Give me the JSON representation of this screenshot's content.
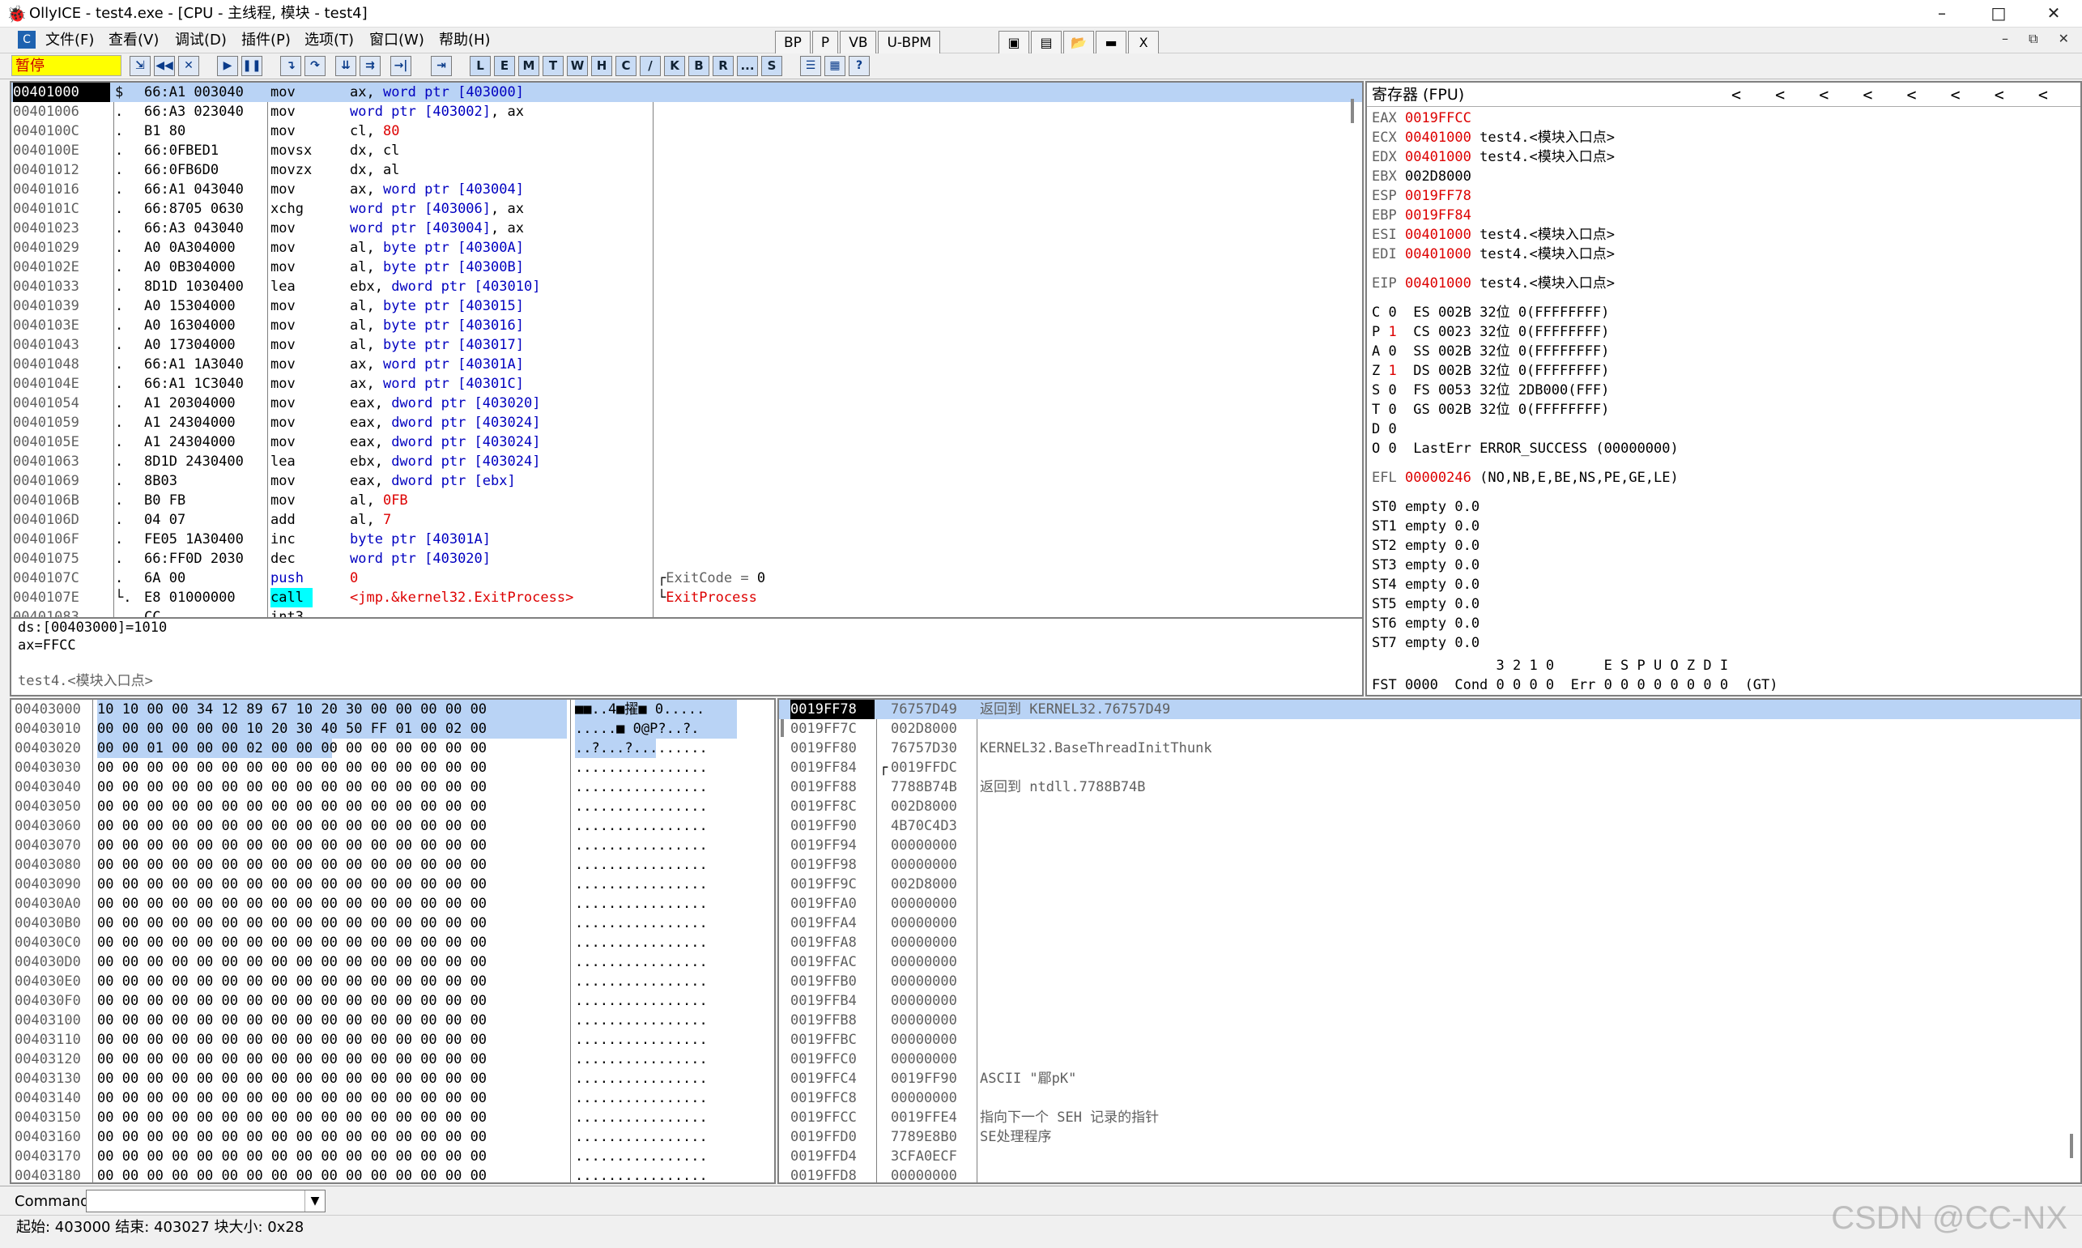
{
  "window": {
    "title": "OllyICE - test4.exe - [CPU - 主线程, 模块 - test4]",
    "min": "–",
    "max": "□",
    "close": "✕"
  },
  "menu": [
    "文件(F)",
    "查看(V)",
    "调试(D)",
    "插件(P)",
    "选项(T)",
    "窗口(W)",
    "帮助(H)"
  ],
  "main_buttons": [
    "BP",
    "P",
    "VB",
    "U-BPM"
  ],
  "main_close": "X",
  "mdi_controls": "– ⧉ ✕",
  "toolbar": {
    "status": "暂停",
    "letters": [
      "L",
      "E",
      "M",
      "T",
      "W",
      "H",
      "C",
      "/",
      "K",
      "B",
      "R",
      "...",
      "S"
    ]
  },
  "disasm": {
    "rows": [
      {
        "addr": "00401000",
        "mark": "$",
        "hex": "66:A1 003040",
        "mn": "mov",
        "op": [
          [
            "ax, ",
            ""
          ],
          [
            "word ptr",
            "blue"
          ],
          [
            " [403000]",
            "blue"
          ]
        ],
        "cm": []
      },
      {
        "addr": "00401006",
        "mark": ".",
        "hex": "66:A3 023040",
        "mn": "mov",
        "op": [
          [
            "word ptr",
            "blue"
          ],
          [
            " [403002]",
            "blue"
          ],
          [
            ", ax",
            ""
          ]
        ],
        "cm": []
      },
      {
        "addr": "0040100C",
        "mark": ".",
        "hex": "B1 80",
        "mn": "mov",
        "op": [
          [
            "cl, ",
            ""
          ],
          [
            "80",
            "red"
          ]
        ],
        "cm": []
      },
      {
        "addr": "0040100E",
        "mark": ".",
        "hex": "66:0FBED1",
        "mn": "movsx",
        "op": [
          [
            "dx, cl",
            ""
          ]
        ],
        "cm": []
      },
      {
        "addr": "00401012",
        "mark": ".",
        "hex": "66:0FB6D0",
        "mn": "movzx",
        "op": [
          [
            "dx, al",
            ""
          ]
        ],
        "cm": []
      },
      {
        "addr": "00401016",
        "mark": ".",
        "hex": "66:A1 043040",
        "mn": "mov",
        "op": [
          [
            "ax, ",
            ""
          ],
          [
            "word ptr",
            "blue"
          ],
          [
            " [403004]",
            "blue"
          ]
        ],
        "cm": []
      },
      {
        "addr": "0040101C",
        "mark": ".",
        "hex": "66:8705 0630",
        "mn": "xchg",
        "op": [
          [
            "word ptr",
            "blue"
          ],
          [
            " [403006]",
            "blue"
          ],
          [
            ", ax",
            ""
          ]
        ],
        "cm": []
      },
      {
        "addr": "00401023",
        "mark": ".",
        "hex": "66:A3 043040",
        "mn": "mov",
        "op": [
          [
            "word ptr",
            "blue"
          ],
          [
            " [403004]",
            "blue"
          ],
          [
            ", ax",
            ""
          ]
        ],
        "cm": []
      },
      {
        "addr": "00401029",
        "mark": ".",
        "hex": "A0 0A304000",
        "mn": "mov",
        "op": [
          [
            "al, ",
            ""
          ],
          [
            "byte ptr",
            "blue"
          ],
          [
            " [40300A]",
            "blue"
          ]
        ],
        "cm": []
      },
      {
        "addr": "0040102E",
        "mark": ".",
        "hex": "A0 0B304000",
        "mn": "mov",
        "op": [
          [
            "al, ",
            ""
          ],
          [
            "byte ptr",
            "blue"
          ],
          [
            " [40300B]",
            "blue"
          ]
        ],
        "cm": []
      },
      {
        "addr": "00401033",
        "mark": ".",
        "hex": "8D1D 1030400",
        "mn": "lea",
        "op": [
          [
            "ebx, ",
            ""
          ],
          [
            "dword ptr",
            "blue"
          ],
          [
            " [403010]",
            "blue"
          ]
        ],
        "cm": []
      },
      {
        "addr": "00401039",
        "mark": ".",
        "hex": "A0 15304000",
        "mn": "mov",
        "op": [
          [
            "al, ",
            ""
          ],
          [
            "byte ptr",
            "blue"
          ],
          [
            " [403015]",
            "blue"
          ]
        ],
        "cm": []
      },
      {
        "addr": "0040103E",
        "mark": ".",
        "hex": "A0 16304000",
        "mn": "mov",
        "op": [
          [
            "al, ",
            ""
          ],
          [
            "byte ptr",
            "blue"
          ],
          [
            " [403016]",
            "blue"
          ]
        ],
        "cm": []
      },
      {
        "addr": "00401043",
        "mark": ".",
        "hex": "A0 17304000",
        "mn": "mov",
        "op": [
          [
            "al, ",
            ""
          ],
          [
            "byte ptr",
            "blue"
          ],
          [
            " [403017]",
            "blue"
          ]
        ],
        "cm": []
      },
      {
        "addr": "00401048",
        "mark": ".",
        "hex": "66:A1 1A3040",
        "mn": "mov",
        "op": [
          [
            "ax, ",
            ""
          ],
          [
            "word ptr",
            "blue"
          ],
          [
            " [40301A]",
            "blue"
          ]
        ],
        "cm": []
      },
      {
        "addr": "0040104E",
        "mark": ".",
        "hex": "66:A1 1C3040",
        "mn": "mov",
        "op": [
          [
            "ax, ",
            ""
          ],
          [
            "word ptr",
            "blue"
          ],
          [
            " [40301C]",
            "blue"
          ]
        ],
        "cm": []
      },
      {
        "addr": "00401054",
        "mark": ".",
        "hex": "A1 20304000",
        "mn": "mov",
        "op": [
          [
            "eax, ",
            ""
          ],
          [
            "dword ptr",
            "blue"
          ],
          [
            " [403020]",
            "blue"
          ]
        ],
        "cm": []
      },
      {
        "addr": "00401059",
        "mark": ".",
        "hex": "A1 24304000",
        "mn": "mov",
        "op": [
          [
            "eax, ",
            ""
          ],
          [
            "dword ptr",
            "blue"
          ],
          [
            " [403024]",
            "blue"
          ]
        ],
        "cm": []
      },
      {
        "addr": "0040105E",
        "mark": ".",
        "hex": "A1 24304000",
        "mn": "mov",
        "op": [
          [
            "eax, ",
            ""
          ],
          [
            "dword ptr",
            "blue"
          ],
          [
            " [403024]",
            "blue"
          ]
        ],
        "cm": []
      },
      {
        "addr": "00401063",
        "mark": ".",
        "hex": "8D1D 2430400",
        "mn": "lea",
        "op": [
          [
            "ebx, ",
            ""
          ],
          [
            "dword ptr",
            "blue"
          ],
          [
            " [403024]",
            "blue"
          ]
        ],
        "cm": []
      },
      {
        "addr": "00401069",
        "mark": ".",
        "hex": "8B03",
        "mn": "mov",
        "op": [
          [
            "eax, ",
            ""
          ],
          [
            "dword ptr",
            "blue"
          ],
          [
            " [ebx]",
            "blue"
          ]
        ],
        "cm": []
      },
      {
        "addr": "0040106B",
        "mark": ".",
        "hex": "B0 FB",
        "mn": "mov",
        "op": [
          [
            "al, ",
            ""
          ],
          [
            "0FB",
            "red"
          ]
        ],
        "cm": []
      },
      {
        "addr": "0040106D",
        "mark": ".",
        "hex": "04 07",
        "mn": "add",
        "op": [
          [
            "al, ",
            ""
          ],
          [
            "7",
            "red"
          ]
        ],
        "cm": []
      },
      {
        "addr": "0040106F",
        "mark": ".",
        "hex": "FE05 1A30400",
        "mn": "inc",
        "op": [
          [
            "byte ptr",
            "blue"
          ],
          [
            " [40301A]",
            "blue"
          ]
        ],
        "cm": []
      },
      {
        "addr": "00401075",
        "mark": ".",
        "hex": "66:FF0D 2030",
        "mn": "dec",
        "op": [
          [
            "word ptr",
            "blue"
          ],
          [
            " [403020]",
            "blue"
          ]
        ],
        "cm": []
      },
      {
        "addr": "0040107C",
        "mark": ".",
        "hex": "6A 00",
        "mn": "push",
        "op": [
          [
            "0",
            "red"
          ]
        ],
        "cm": [
          [
            "┌",
            ""
          ],
          [
            "ExitCode = ",
            "gray"
          ],
          [
            "0",
            ""
          ]
        ]
      },
      {
        "addr": "0040107E",
        "mark": "└.",
        "hex": "E8 01000000",
        "mn": "call",
        "op": [
          [
            "<jmp.&kernel32.ExitProcess>",
            "red"
          ]
        ],
        "cm": [
          [
            "└",
            ""
          ],
          [
            "ExitProcess",
            "red"
          ]
        ]
      },
      {
        "addr": "00401083",
        "mark": "",
        "hex": "CC",
        "mn": "int3",
        "op": [],
        "cm": []
      }
    ],
    "info": [
      "ds:[00403000]=1010",
      "ax=FFCC",
      "",
      "test4.<模块入口点>"
    ]
  },
  "registers": {
    "header": "寄存器 (FPU)",
    "arrows": "<  <  <  <  <  <  <  <",
    "gp": [
      {
        "n": "EAX",
        "v": "0019FFCC",
        "c": ""
      },
      {
        "n": "ECX",
        "v": "00401000",
        "c": "test4.<模块入口点>"
      },
      {
        "n": "EDX",
        "v": "00401000",
        "c": "test4.<模块入口点>"
      },
      {
        "n": "EBX",
        "v": "002D8000",
        "c": ""
      },
      {
        "n": "ESP",
        "v": "0019FF78",
        "c": ""
      },
      {
        "n": "EBP",
        "v": "0019FF84",
        "c": ""
      },
      {
        "n": "ESI",
        "v": "00401000",
        "c": "test4.<模块入口点>"
      },
      {
        "n": "EDI",
        "v": "00401000",
        "c": "test4.<模块入口点>"
      }
    ],
    "eip": {
      "n": "EIP",
      "v": "00401000",
      "c": "test4.<模块入口点>"
    },
    "flags": [
      {
        "f": "C",
        "v": "0",
        "rest": "ES 002B 32位 0(FFFFFFFF)"
      },
      {
        "f": "P",
        "v": "1",
        "rest": "CS 0023 32位 0(FFFFFFFF)"
      },
      {
        "f": "A",
        "v": "0",
        "rest": "SS 002B 32位 0(FFFFFFFF)"
      },
      {
        "f": "Z",
        "v": "1",
        "rest": "DS 002B 32位 0(FFFFFFFF)"
      },
      {
        "f": "S",
        "v": "0",
        "rest": "FS 0053 32位 2DB000(FFF)"
      },
      {
        "f": "T",
        "v": "0",
        "rest": "GS 002B 32位 0(FFFFFFFF)"
      },
      {
        "f": "D",
        "v": "0",
        "rest": ""
      },
      {
        "f": "O",
        "v": "0",
        "rest": "LastErr ERROR_SUCCESS (00000000)"
      }
    ],
    "efl": {
      "n": "EFL",
      "v": "00000246",
      "c": "(NO,NB,E,BE,NS,PE,GE,LE)"
    },
    "fpu": [
      "ST0 empty 0.0",
      "ST1 empty 0.0",
      "ST2 empty 0.0",
      "ST3 empty 0.0",
      "ST4 empty 0.0",
      "ST5 empty 0.0",
      "ST6 empty 0.0",
      "ST7 empty 0.0"
    ],
    "fst_hdr": "               3 2 1 0      E S P U O Z D I",
    "fst": "FST 0000  Cond 0 0 0 0  Err 0 0 0 0 0 0 0 0  (GT)"
  },
  "dump": {
    "rows": [
      {
        "a": "00403000",
        "h": "10 10 00 00 34 12 89 67 10 20 30 00 00 00 00 00",
        "s": "■■..4■擢■ 0.....",
        "sel": 16
      },
      {
        "a": "00403010",
        "h": "00 00 00 00 00 00 10 20 30 40 50 FF 01 00 02 00",
        "s": ".....■ 0@P?..?.",
        "sel": 16
      },
      {
        "a": "00403020",
        "h": "00 00 01 00 00 00 02 00 00 00 00 00 00 00 00 00",
        "s": "..?...?.........",
        "sel": 8
      },
      {
        "a": "00403030",
        "h": "00 00 00 00 00 00 00 00 00 00 00 00 00 00 00 00",
        "s": "................",
        "sel": 0
      },
      {
        "a": "00403040",
        "h": "00 00 00 00 00 00 00 00 00 00 00 00 00 00 00 00",
        "s": "................",
        "sel": 0
      },
      {
        "a": "00403050",
        "h": "00 00 00 00 00 00 00 00 00 00 00 00 00 00 00 00",
        "s": "................",
        "sel": 0
      },
      {
        "a": "00403060",
        "h": "00 00 00 00 00 00 00 00 00 00 00 00 00 00 00 00",
        "s": "................",
        "sel": 0
      },
      {
        "a": "00403070",
        "h": "00 00 00 00 00 00 00 00 00 00 00 00 00 00 00 00",
        "s": "................",
        "sel": 0
      },
      {
        "a": "00403080",
        "h": "00 00 00 00 00 00 00 00 00 00 00 00 00 00 00 00",
        "s": "................",
        "sel": 0
      },
      {
        "a": "00403090",
        "h": "00 00 00 00 00 00 00 00 00 00 00 00 00 00 00 00",
        "s": "................",
        "sel": 0
      },
      {
        "a": "004030A0",
        "h": "00 00 00 00 00 00 00 00 00 00 00 00 00 00 00 00",
        "s": "................",
        "sel": 0
      },
      {
        "a": "004030B0",
        "h": "00 00 00 00 00 00 00 00 00 00 00 00 00 00 00 00",
        "s": "................",
        "sel": 0
      },
      {
        "a": "004030C0",
        "h": "00 00 00 00 00 00 00 00 00 00 00 00 00 00 00 00",
        "s": "................",
        "sel": 0
      },
      {
        "a": "004030D0",
        "h": "00 00 00 00 00 00 00 00 00 00 00 00 00 00 00 00",
        "s": "................",
        "sel": 0
      },
      {
        "a": "004030E0",
        "h": "00 00 00 00 00 00 00 00 00 00 00 00 00 00 00 00",
        "s": "................",
        "sel": 0
      },
      {
        "a": "004030F0",
        "h": "00 00 00 00 00 00 00 00 00 00 00 00 00 00 00 00",
        "s": "................",
        "sel": 0
      },
      {
        "a": "00403100",
        "h": "00 00 00 00 00 00 00 00 00 00 00 00 00 00 00 00",
        "s": "................",
        "sel": 0
      },
      {
        "a": "00403110",
        "h": "00 00 00 00 00 00 00 00 00 00 00 00 00 00 00 00",
        "s": "................",
        "sel": 0
      },
      {
        "a": "00403120",
        "h": "00 00 00 00 00 00 00 00 00 00 00 00 00 00 00 00",
        "s": "................",
        "sel": 0
      },
      {
        "a": "00403130",
        "h": "00 00 00 00 00 00 00 00 00 00 00 00 00 00 00 00",
        "s": "................",
        "sel": 0
      },
      {
        "a": "00403140",
        "h": "00 00 00 00 00 00 00 00 00 00 00 00 00 00 00 00",
        "s": "................",
        "sel": 0
      },
      {
        "a": "00403150",
        "h": "00 00 00 00 00 00 00 00 00 00 00 00 00 00 00 00",
        "s": "................",
        "sel": 0
      },
      {
        "a": "00403160",
        "h": "00 00 00 00 00 00 00 00 00 00 00 00 00 00 00 00",
        "s": "................",
        "sel": 0
      },
      {
        "a": "00403170",
        "h": "00 00 00 00 00 00 00 00 00 00 00 00 00 00 00 00",
        "s": "................",
        "sel": 0
      },
      {
        "a": "00403180",
        "h": "00 00 00 00 00 00 00 00 00 00 00 00 00 00 00 00",
        "s": "................",
        "sel": 0
      }
    ]
  },
  "stack": {
    "rows": [
      {
        "a": "0019FF78",
        "v": "76757D49",
        "c": "返回到 KERNEL32.76757D49",
        "m": ""
      },
      {
        "a": "0019FF7C",
        "v": "002D8000",
        "c": "",
        "m": ""
      },
      {
        "a": "0019FF80",
        "v": "76757D30",
        "c": "KERNEL32.BaseThreadInitThunk",
        "m": ""
      },
      {
        "a": "0019FF84",
        "v": "0019FFDC",
        "c": "",
        "m": "┌"
      },
      {
        "a": "0019FF88",
        "v": "7788B74B",
        "c": "返回到 ntdll.7788B74B",
        "m": ""
      },
      {
        "a": "0019FF8C",
        "v": "002D8000",
        "c": "",
        "m": ""
      },
      {
        "a": "0019FF90",
        "v": "4B70C4D3",
        "c": "",
        "m": ""
      },
      {
        "a": "0019FF94",
        "v": "00000000",
        "c": "",
        "m": ""
      },
      {
        "a": "0019FF98",
        "v": "00000000",
        "c": "",
        "m": ""
      },
      {
        "a": "0019FF9C",
        "v": "002D8000",
        "c": "",
        "m": ""
      },
      {
        "a": "0019FFA0",
        "v": "00000000",
        "c": "",
        "m": ""
      },
      {
        "a": "0019FFA4",
        "v": "00000000",
        "c": "",
        "m": ""
      },
      {
        "a": "0019FFA8",
        "v": "00000000",
        "c": "",
        "m": ""
      },
      {
        "a": "0019FFAC",
        "v": "00000000",
        "c": "",
        "m": ""
      },
      {
        "a": "0019FFB0",
        "v": "00000000",
        "c": "",
        "m": ""
      },
      {
        "a": "0019FFB4",
        "v": "00000000",
        "c": "",
        "m": ""
      },
      {
        "a": "0019FFB8",
        "v": "00000000",
        "c": "",
        "m": ""
      },
      {
        "a": "0019FFBC",
        "v": "00000000",
        "c": "",
        "m": ""
      },
      {
        "a": "0019FFC0",
        "v": "00000000",
        "c": "",
        "m": ""
      },
      {
        "a": "0019FFC4",
        "v": "0019FF90",
        "c": "ASCII \"郿pK\"",
        "m": ""
      },
      {
        "a": "0019FFC8",
        "v": "00000000",
        "c": "",
        "m": ""
      },
      {
        "a": "0019FFCC",
        "v": "0019FFE4",
        "c": "指向下一个 SEH 记录的指针",
        "m": ""
      },
      {
        "a": "0019FFD0",
        "v": "7789E8B0",
        "c": "SE处理程序",
        "m": ""
      },
      {
        "a": "0019FFD4",
        "v": "3CFA0ECF",
        "c": "",
        "m": ""
      },
      {
        "a": "0019FFD8",
        "v": "00000000",
        "c": "",
        "m": ""
      }
    ]
  },
  "command": {
    "label": "Command",
    "value": ""
  },
  "status_bar": "起始: 403000 结束: 403027 块大小: 0x28",
  "watermark": "CSDN @CC-NX"
}
